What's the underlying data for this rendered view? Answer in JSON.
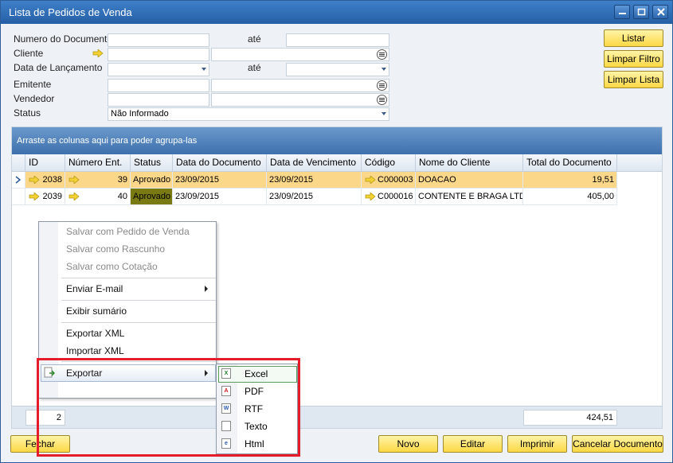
{
  "window": {
    "title": "Lista de Pedidos de Venda"
  },
  "filters": {
    "numero_label": "Numero do Documento",
    "ate1_label": "até",
    "cliente_label": "Cliente",
    "data_lanc_label": "Data de Lançamento",
    "ate2_label": "até",
    "emitente_label": "Emitente",
    "vendedor_label": "Vendedor",
    "status_label": "Status",
    "status_value": "Não Informado"
  },
  "side_buttons": {
    "listar": "Listar",
    "limpar_filtro": "Limpar Filtro",
    "limpar_lista": "Limpar Lista"
  },
  "grid": {
    "group_hint": "Arraste as colunas aqui para poder agrupa-las",
    "columns": [
      "ID",
      "Número Ent.",
      "Status",
      "Data do Documento",
      "Data de Vencimento",
      "Código",
      "Nome do Cliente",
      "Total do Documento"
    ],
    "rows": [
      {
        "id": "2038",
        "numero": "39",
        "status": "Aprovado",
        "data_doc": "23/09/2015",
        "data_venc": "23/09/2015",
        "codigo": "C000003",
        "cliente": "DOACAO",
        "total": "19,51"
      },
      {
        "id": "2039",
        "numero": "40",
        "status": "Aprovado",
        "data_doc": "23/09/2015",
        "data_venc": "23/09/2015",
        "codigo": "C000016",
        "cliente": "CONTENTE E BRAGA LTDA",
        "total": "405,00"
      }
    ],
    "footer_count": "2",
    "footer_total": "424,51"
  },
  "context_menu": {
    "items": [
      "Salvar com Pedido de Venda",
      "Salvar como Rascunho",
      "Salvar como Cotação",
      "Enviar E-mail",
      "Exibir sumário",
      "Exportar XML",
      "Importar XML",
      "Exportar"
    ]
  },
  "submenu": {
    "items": [
      {
        "label": "Excel",
        "icon": "X"
      },
      {
        "label": "PDF",
        "icon": "A"
      },
      {
        "label": "RTF",
        "icon": "W"
      },
      {
        "label": "Texto",
        "icon": ""
      },
      {
        "label": "Html",
        "icon": "e"
      }
    ]
  },
  "bottom_buttons": {
    "fechar": "Fechar",
    "novo": "Novo",
    "editar": "Editar",
    "imprimir": "Imprimir",
    "cancelar": "Cancelar Documento"
  },
  "colors": {
    "titlebar": "#2f6fb8",
    "button_yellow": "#fcd845",
    "selected_row": "#fbd78a",
    "highlight_red": "#e51c2a",
    "status_olive": "#7a7a12"
  }
}
